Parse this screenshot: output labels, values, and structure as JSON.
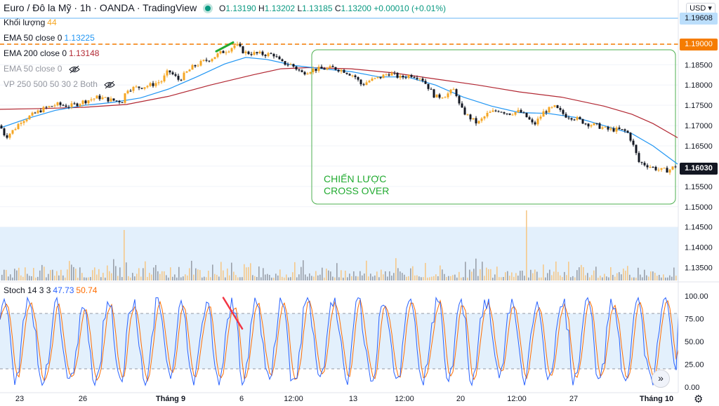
{
  "header": {
    "title_parts": [
      "Euro / Đô la Mỹ",
      "1h",
      "OANDA",
      "TradingView"
    ],
    "ohlc": {
      "o_label": "O",
      "o": "1.13190",
      "h_label": "H",
      "h": "1.13202",
      "l_label": "L",
      "l": "1.13185",
      "c_label": "C",
      "c": "1.13200",
      "change": "+0.00010 (+0.01%)"
    }
  },
  "legend": {
    "volume_label": "Khối lượng",
    "volume_value": "44",
    "ema50_label": "EMA 50 close 0",
    "ema50_value": "1.13225",
    "ema200_label": "EMA 200 close 0",
    "ema200_value": "1.13148",
    "ema50_hidden_label": "EMA 50 close 0",
    "vp_label": "VP 250 500 50 30 2 Both",
    "stoch_label": "Stoch 14 3 3",
    "stoch_k": "47.73",
    "stoch_d": "50.74"
  },
  "currency_button": "USD",
  "price_tags": {
    "top": "1.19608",
    "level": "1.19000",
    "last": "1.16030"
  },
  "annotation": {
    "line1": "CHIẾN LƯỢC",
    "line2": "CROSS OVER"
  },
  "colors": {
    "up": "#f5a623",
    "down": "#131722",
    "ema50": "#2196f3",
    "ema200": "#b22833",
    "stoch_k": "#2962ff",
    "stoch_d": "#ff6d00",
    "box": "#22ab31",
    "dash_level": "#f57c00",
    "volume_bg": "#e3f0fc",
    "stoch_band": "#e3f0fc"
  },
  "chart_data": [
    {
      "type": "candlestick",
      "pair": "EUR/USD",
      "timeframe": "1h",
      "x_ticks": [
        "23",
        "26",
        "Tháng 9",
        "6",
        "12:00",
        "13",
        "12:00",
        "20",
        "12:00",
        "27",
        "Tháng 10"
      ],
      "y_ticks": [
        "1.19000",
        "1.18500",
        "1.18000",
        "1.17500",
        "1.17000",
        "1.16500",
        "1.16000",
        "1.15500",
        "1.15000",
        "1.14500",
        "1.14000",
        "1.13500"
      ],
      "ylim": [
        1.1325,
        1.1975
      ],
      "close_path": [
        [
          0,
          1.17
        ],
        [
          8,
          1.1672
        ],
        [
          20,
          1.169
        ],
        [
          30,
          1.1712
        ],
        [
          45,
          1.1725
        ],
        [
          60,
          1.174
        ],
        [
          80,
          1.1752
        ],
        [
          100,
          1.1748
        ],
        [
          120,
          1.176
        ],
        [
          140,
          1.177
        ],
        [
          160,
          1.1762
        ],
        [
          175,
          1.176
        ],
        [
          180,
          1.179
        ],
        [
          200,
          1.1795
        ],
        [
          215,
          1.18
        ],
        [
          230,
          1.181
        ],
        [
          240,
          1.1835
        ],
        [
          255,
          1.1812
        ],
        [
          265,
          1.183
        ],
        [
          275,
          1.1845
        ],
        [
          290,
          1.1858
        ],
        [
          300,
          1.1865
        ],
        [
          315,
          1.188
        ],
        [
          325,
          1.1887
        ],
        [
          336,
          1.19
        ],
        [
          348,
          1.188
        ],
        [
          360,
          1.1878
        ],
        [
          375,
          1.1876
        ],
        [
          390,
          1.1875
        ],
        [
          400,
          1.1855
        ],
        [
          415,
          1.185
        ],
        [
          430,
          1.183
        ],
        [
          445,
          1.1838
        ],
        [
          460,
          1.184
        ],
        [
          475,
          1.1842
        ],
        [
          490,
          1.1835
        ],
        [
          505,
          1.1822
        ],
        [
          515,
          1.18
        ],
        [
          525,
          1.181
        ],
        [
          540,
          1.1818
        ],
        [
          555,
          1.183
        ],
        [
          570,
          1.1818
        ],
        [
          585,
          1.1825
        ],
        [
          600,
          1.1818
        ],
        [
          612,
          1.179
        ],
        [
          620,
          1.177
        ],
        [
          635,
          1.1775
        ],
        [
          648,
          1.179
        ],
        [
          655,
          1.1745
        ],
        [
          665,
          1.1725
        ],
        [
          680,
          1.1705
        ],
        [
          695,
          1.173
        ],
        [
          710,
          1.1738
        ],
        [
          725,
          1.173
        ],
        [
          740,
          1.1735
        ],
        [
          752,
          1.1718
        ],
        [
          760,
          1.17
        ],
        [
          775,
          1.1735
        ],
        [
          790,
          1.1745
        ],
        [
          805,
          1.1725
        ],
        [
          820,
          1.1718
        ],
        [
          835,
          1.1705
        ],
        [
          850,
          1.17
        ],
        [
          865,
          1.169
        ],
        [
          880,
          1.169
        ],
        [
          893,
          1.1685
        ],
        [
          900,
          1.166
        ],
        [
          910,
          1.161
        ],
        [
          925,
          1.16
        ],
        [
          940,
          1.159
        ],
        [
          952,
          1.159
        ],
        [
          965,
          1.1603
        ]
      ],
      "ema50_path": [
        [
          0,
          1.1694
        ],
        [
          40,
          1.1718
        ],
        [
          80,
          1.1738
        ],
        [
          120,
          1.175
        ],
        [
          160,
          1.1757
        ],
        [
          200,
          1.1768
        ],
        [
          240,
          1.179
        ],
        [
          280,
          1.182
        ],
        [
          320,
          1.1852
        ],
        [
          350,
          1.1868
        ],
        [
          380,
          1.1863
        ],
        [
          420,
          1.1848
        ],
        [
          460,
          1.184
        ],
        [
          500,
          1.1833
        ],
        [
          540,
          1.182
        ],
        [
          580,
          1.182
        ],
        [
          620,
          1.18
        ],
        [
          660,
          1.177
        ],
        [
          700,
          1.1748
        ],
        [
          740,
          1.1732
        ],
        [
          780,
          1.173
        ],
        [
          820,
          1.172
        ],
        [
          860,
          1.17
        ],
        [
          900,
          1.168
        ],
        [
          930,
          1.165
        ],
        [
          965,
          1.1605
        ]
      ],
      "ema200_path": [
        [
          0,
          1.174
        ],
        [
          60,
          1.1742
        ],
        [
          120,
          1.1745
        ],
        [
          180,
          1.1752
        ],
        [
          240,
          1.1772
        ],
        [
          300,
          1.18
        ],
        [
          360,
          1.1825
        ],
        [
          400,
          1.184
        ],
        [
          440,
          1.1843
        ],
        [
          500,
          1.184
        ],
        [
          560,
          1.183
        ],
        [
          620,
          1.1815
        ],
        [
          680,
          1.18
        ],
        [
          740,
          1.1783
        ],
        [
          800,
          1.177
        ],
        [
          860,
          1.1748
        ],
        [
          900,
          1.1728
        ],
        [
          930,
          1.1705
        ],
        [
          965,
          1.167
        ]
      ],
      "horizontal_level": 1.19,
      "trendline_green": [
        [
          308,
          1.1883
        ],
        [
          332,
          1.1905
        ]
      ]
    },
    {
      "type": "bar",
      "name": "Khối lượng",
      "spike_at_x": 750
    },
    {
      "type": "line",
      "name": "Stoch 14 3 3",
      "y_ticks": [
        "100.00",
        "75.00",
        "50.00",
        "25.00",
        "0.00"
      ],
      "ylim": [
        0,
        100
      ],
      "bands": [
        20,
        80
      ],
      "k_last": 47.73,
      "d_last": 50.74,
      "trendline_red": [
        [
          318,
          98
        ],
        [
          345,
          64
        ]
      ]
    }
  ]
}
